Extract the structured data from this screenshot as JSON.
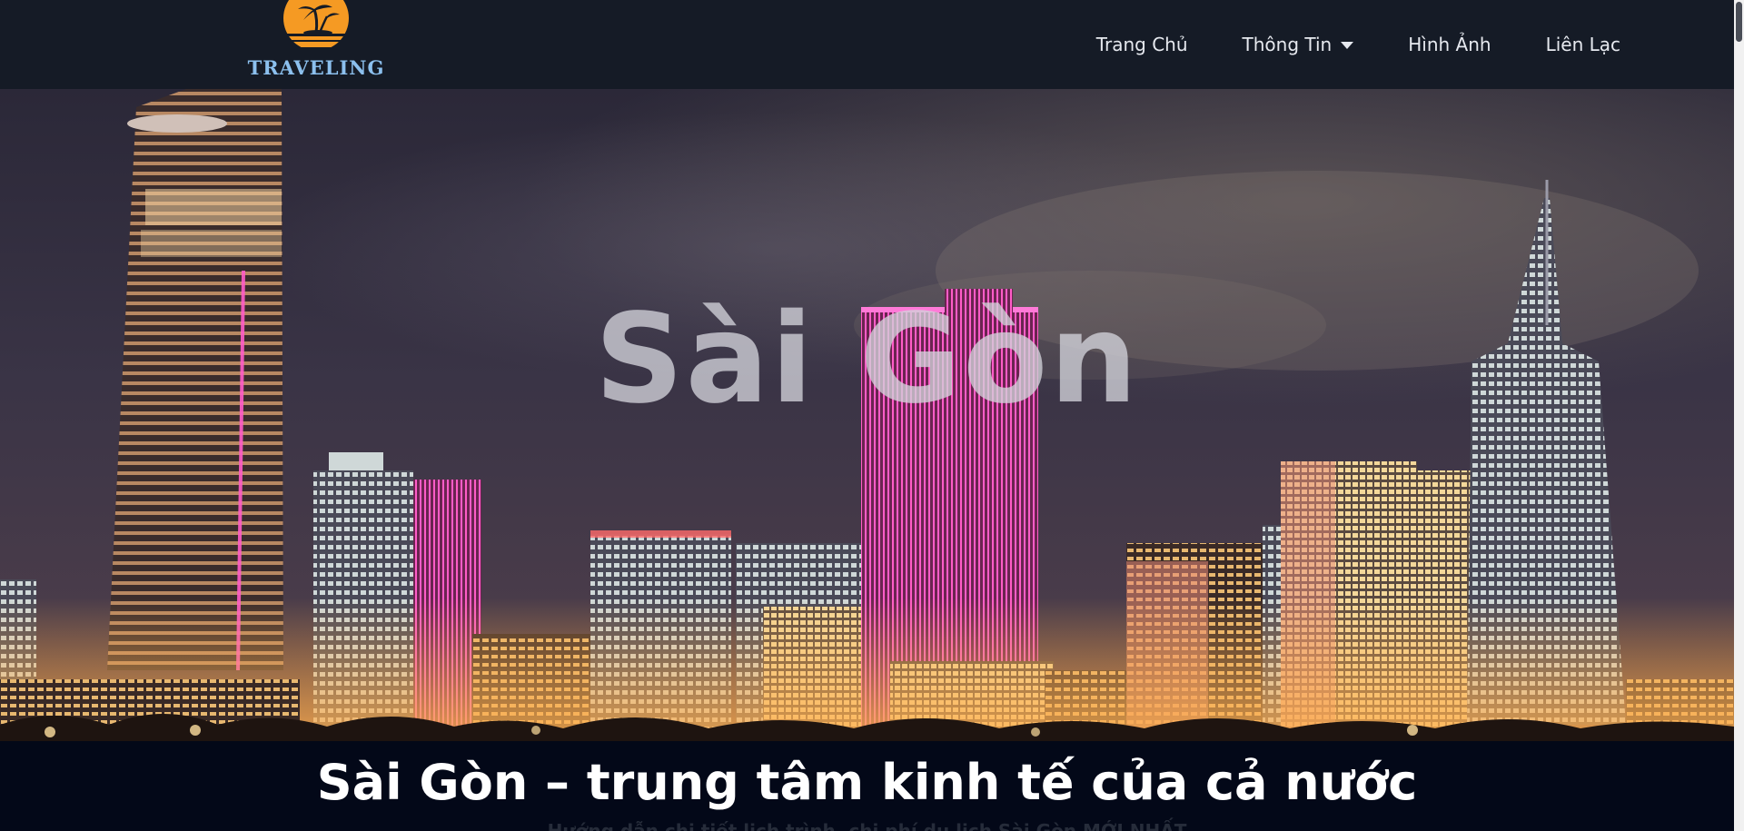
{
  "brand": {
    "name": "TRAVELING",
    "colors": {
      "logo_text": "#8cc0ee",
      "sun": "#f59a23",
      "navbar_bg": "#151b26"
    }
  },
  "nav": {
    "items": [
      {
        "label": "Trang Chủ",
        "has_dropdown": false
      },
      {
        "label": "Thông Tin",
        "has_dropdown": true
      },
      {
        "label": "Hình Ảnh",
        "has_dropdown": false
      },
      {
        "label": "Liên Lạc",
        "has_dropdown": false
      }
    ]
  },
  "hero": {
    "title": "Sài Gòn",
    "image_description_icon": "city-skyline-night"
  },
  "section": {
    "headline": "Sài Gòn – trung tâm kinh tế của cả nước",
    "subline": "Hướng dẫn chi tiết lịch trình, chi phí du lịch Sài Gòn MỚI NHẤT"
  }
}
